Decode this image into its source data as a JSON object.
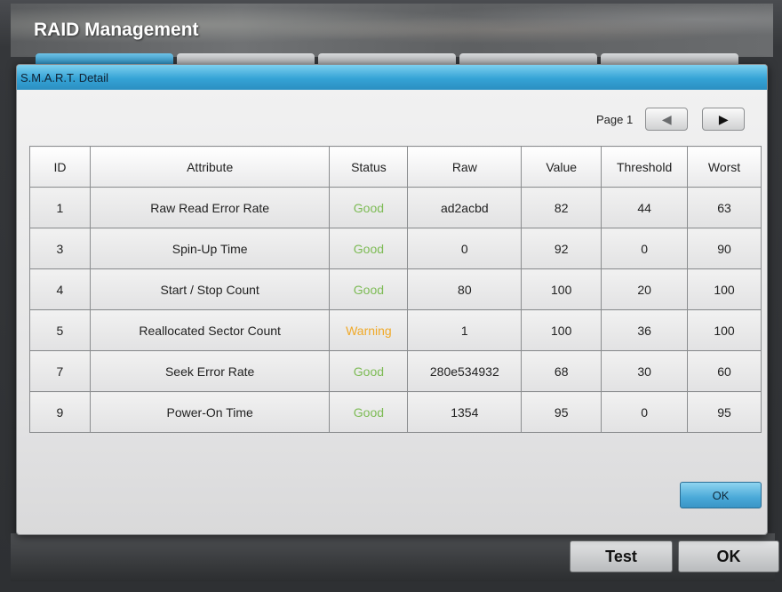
{
  "window": {
    "title": "RAID Management",
    "buttons": {
      "test": "Test",
      "ok": "OK"
    }
  },
  "dialog": {
    "title": "S.M.A.R.T. Detail",
    "page_label": "Page 1",
    "ok_label": "OK",
    "columns": [
      "ID",
      "Attribute",
      "Status",
      "Raw",
      "Value",
      "Threshold",
      "Worst"
    ],
    "rows": [
      [
        "1",
        "Raw Read Error Rate",
        "Good",
        "ad2acbd",
        "82",
        "44",
        "63"
      ],
      [
        "3",
        "Spin-Up Time",
        "Good",
        "0",
        "92",
        "0",
        "90"
      ],
      [
        "4",
        "Start / Stop Count",
        "Good",
        "80",
        "100",
        "20",
        "100"
      ],
      [
        "5",
        "Reallocated Sector Count",
        "Warning",
        "1",
        "100",
        "36",
        "100"
      ],
      [
        "7",
        "Seek Error Rate",
        "Good",
        "280e534932",
        "68",
        "30",
        "60"
      ],
      [
        "9",
        "Power-On Time",
        "Good",
        "1354",
        "95",
        "0",
        "95"
      ]
    ]
  },
  "icons": {
    "prev": "triangle-left-icon",
    "next": "triangle-right-icon"
  },
  "colors": {
    "accent": "#35a3d6",
    "status_good": "#7dbb55",
    "status_warning": "#f0a928"
  }
}
